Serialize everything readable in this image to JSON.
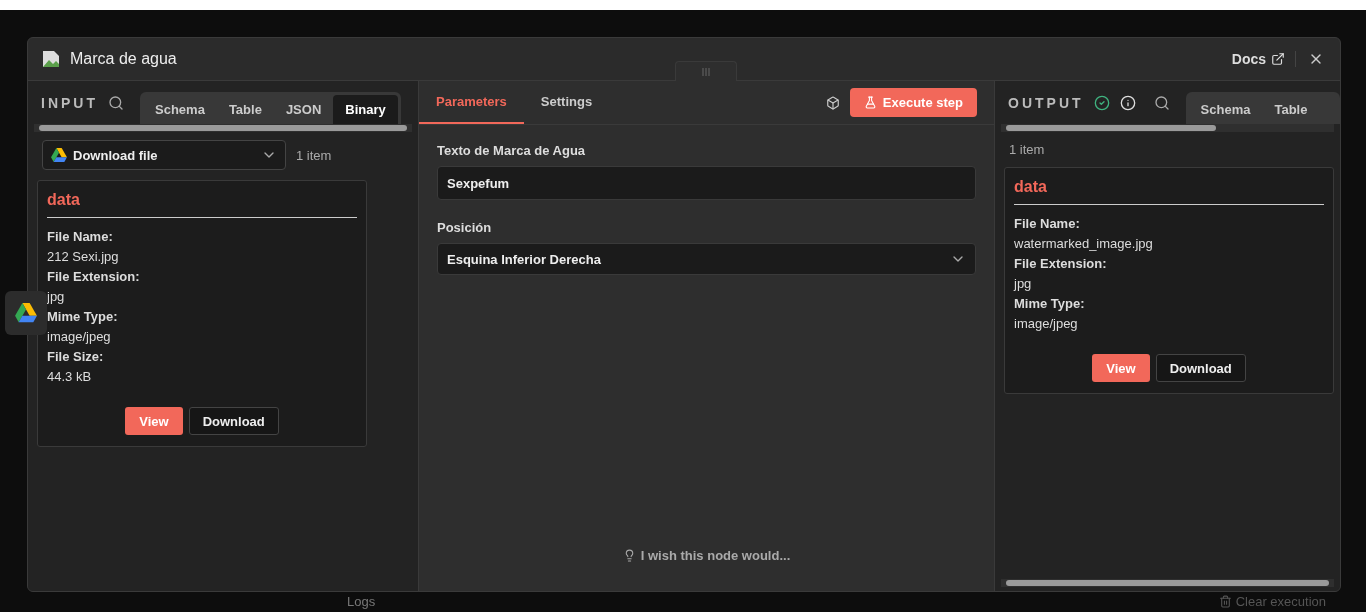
{
  "modal": {
    "title": "Marca de agua",
    "docs_link": "Docs"
  },
  "input": {
    "heading": "INPUT",
    "tabs": [
      {
        "label": "Schema",
        "selected": false
      },
      {
        "label": "Table",
        "selected": false
      },
      {
        "label": "JSON",
        "selected": false
      },
      {
        "label": "Binary",
        "selected": true
      }
    ],
    "node_select": "Download file",
    "item_count": "1 item",
    "binary": {
      "title": "data",
      "fields": [
        {
          "label": "File Name:",
          "value": "212 Sexi.jpg"
        },
        {
          "label": "File Extension:",
          "value": "jpg"
        },
        {
          "label": "Mime Type:",
          "value": "image/jpeg"
        },
        {
          "label": "File Size:",
          "value": "44.3 kB"
        }
      ],
      "buttons": [
        "View",
        "Download"
      ]
    }
  },
  "parameters": {
    "tabs": [
      {
        "label": "Parameters",
        "selected": true
      },
      {
        "label": "Settings",
        "selected": false
      }
    ],
    "execute_button": "Execute step",
    "fields": [
      {
        "kind": "text",
        "label": "Texto de Marca de Agua",
        "value": "Sexpefum"
      },
      {
        "kind": "select",
        "label": "Posición",
        "value": "Esquina Inferior Derecha"
      }
    ],
    "feedback": "I wish this node would..."
  },
  "output": {
    "heading": "OUTPUT",
    "tabs": [
      {
        "label": "Schema",
        "selected": false
      },
      {
        "label": "Table",
        "selected": false
      }
    ],
    "item_count": "1 item",
    "binary": {
      "title": "data",
      "fields": [
        {
          "label": "File Name:",
          "value": "watermarked_image.jpg"
        },
        {
          "label": "File Extension:",
          "value": "jpg"
        },
        {
          "label": "Mime Type:",
          "value": "image/jpeg"
        }
      ],
      "buttons": [
        "View",
        "Download"
      ]
    }
  },
  "background": {
    "logs": "Logs",
    "clear_execution": "Clear execution"
  }
}
